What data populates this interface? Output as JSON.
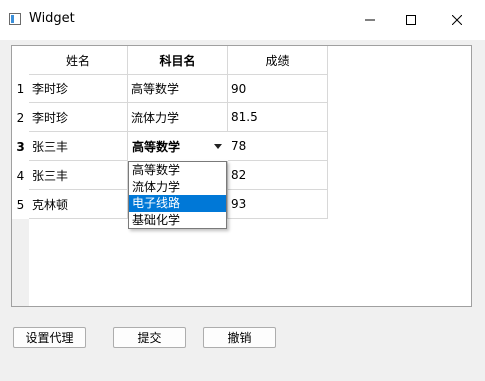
{
  "window": {
    "title": "Widget"
  },
  "table": {
    "columns": [
      "姓名",
      "科目名",
      "成绩"
    ],
    "row_numbers": [
      "1",
      "2",
      "3",
      "4",
      "5"
    ],
    "rows": [
      {
        "name": "李时珍",
        "subject": "高等数学",
        "score": "90"
      },
      {
        "name": "李时珍",
        "subject": "流体力学",
        "score": "81.5"
      },
      {
        "name": "张三丰",
        "subject": "高等数学",
        "score": "78"
      },
      {
        "name": "张三丰",
        "subject": "",
        "score": "82"
      },
      {
        "name": "克林顿",
        "subject": "",
        "score": "93"
      }
    ]
  },
  "combo": {
    "current": "高等数学",
    "options": [
      "高等数学",
      "流体力学",
      "电子线路",
      "基础化学"
    ],
    "highlighted": "电子线路"
  },
  "buttons": {
    "delegate": "设置代理",
    "submit": "提交",
    "revert": "撤销"
  },
  "colors": {
    "selection": "#0078d7"
  }
}
